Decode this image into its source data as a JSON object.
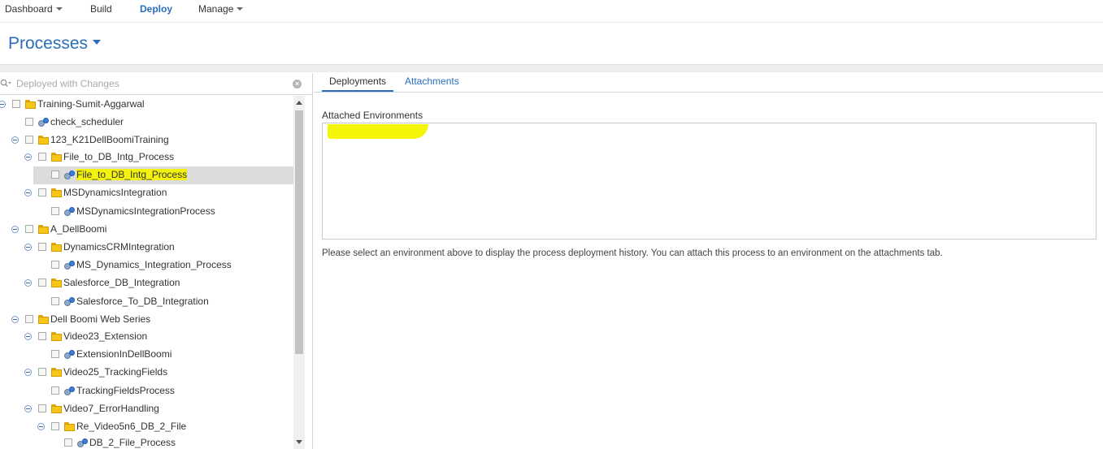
{
  "nav": {
    "items": [
      {
        "label": "Dashboard",
        "has_caret": true,
        "active": false
      },
      {
        "label": "Build",
        "has_caret": false,
        "active": false
      },
      {
        "label": "Deploy",
        "has_caret": false,
        "active": true
      },
      {
        "label": "Manage",
        "has_caret": true,
        "active": false
      }
    ]
  },
  "page": {
    "title": "Processes"
  },
  "filter": {
    "placeholder": "Deployed with Changes",
    "icon": "search-icon"
  },
  "tree": {
    "rows": [
      {
        "label": "Training-Sumit-Aggarwal",
        "type": "folder",
        "level": 0,
        "expanded": true
      },
      {
        "label": "check_scheduler",
        "type": "process",
        "level": 1
      },
      {
        "label": "123_K21DellBoomiTraining",
        "type": "folder",
        "level": 1,
        "expanded": true
      },
      {
        "label": "File_to_DB_Intg_Process",
        "type": "folder",
        "level": 2,
        "expanded": true
      },
      {
        "label": "File_to_DB_Intg_Process",
        "type": "process",
        "level": 3,
        "selected": true,
        "highlighted": true
      },
      {
        "label": "MSDynamicsIntegration",
        "type": "folder",
        "level": 2,
        "expanded": true
      },
      {
        "label": "MSDynamicsIntegrationProcess",
        "type": "process",
        "level": 3
      },
      {
        "label": "A_DellBoomi",
        "type": "folder",
        "level": 1,
        "expanded": true
      },
      {
        "label": "DynamicsCRMIntegration",
        "type": "folder",
        "level": 2,
        "expanded": true
      },
      {
        "label": "MS_Dynamics_Integration_Process",
        "type": "process",
        "level": 3
      },
      {
        "label": "Salesforce_DB_Integration",
        "type": "folder",
        "level": 2,
        "expanded": true
      },
      {
        "label": "Salesforce_To_DB_Integration",
        "type": "process",
        "level": 3
      },
      {
        "label": "Dell Boomi Web Series",
        "type": "folder",
        "level": 1,
        "expanded": true
      },
      {
        "label": "Video23_Extension",
        "type": "folder",
        "level": 2,
        "expanded": true
      },
      {
        "label": "ExtensionInDellBoomi",
        "type": "process",
        "level": 3
      },
      {
        "label": "Video25_TrackingFields",
        "type": "folder",
        "level": 2,
        "expanded": true
      },
      {
        "label": "TrackingFieldsProcess",
        "type": "process",
        "level": 3
      },
      {
        "label": "Video7_ErrorHandling",
        "type": "folder",
        "level": 2,
        "expanded": true
      },
      {
        "label": "Re_Video5n6_DB_2_File",
        "type": "folder",
        "level": 3,
        "expanded": true
      },
      {
        "label": "DB_2_File_Process",
        "type": "process",
        "level": 4
      }
    ]
  },
  "tabs": [
    {
      "label": "Deployments",
      "active": true
    },
    {
      "label": "Attachments",
      "active": false
    }
  ],
  "attached": {
    "label": "Attached Environments",
    "items": []
  },
  "help": {
    "text": "Please select an environment above to display the process deployment history. You can attach this process to an environment on the attachments tab."
  },
  "colors": {
    "accent": "#2a6ebb",
    "highlight": "#f2f20c",
    "selected_row": "#dcdcdc"
  }
}
